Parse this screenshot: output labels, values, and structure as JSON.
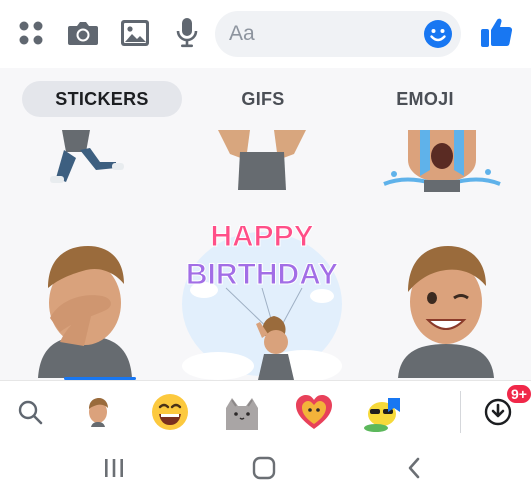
{
  "composer": {
    "placeholder": "Aa",
    "icons": [
      "apps-grid-icon",
      "camera-icon",
      "gallery-icon",
      "microphone-icon",
      "emoji-icon",
      "thumbs-up-icon"
    ],
    "accent": "#1877f2"
  },
  "tabs": [
    {
      "label": "STICKERS",
      "active": true
    },
    {
      "label": "GIFS",
      "active": false
    },
    {
      "label": "EMOJI",
      "active": false
    }
  ],
  "stickers": [
    {
      "name": "avatar-jumping"
    },
    {
      "name": "avatar-arms-up"
    },
    {
      "name": "avatar-crying"
    },
    {
      "name": "avatar-facepalm"
    },
    {
      "name": "avatar-happy-birthday",
      "text": "HAPPY BIRTHDAY"
    },
    {
      "name": "avatar-wink"
    }
  ],
  "packbar": {
    "icons": [
      "search-icon",
      "avatar-pack",
      "laughing-emoji-pack",
      "pusheen-cat-pack",
      "heart-character-pack",
      "sunglasses-character-pack",
      "download-icon"
    ],
    "badge": "9+"
  },
  "nav": {
    "icons": [
      "recent-apps-icon",
      "home-icon",
      "back-icon"
    ]
  }
}
